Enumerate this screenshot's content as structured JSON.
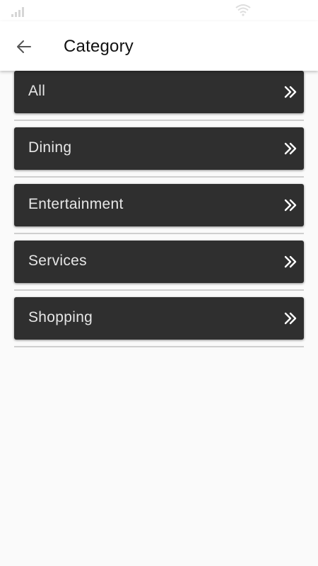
{
  "header": {
    "title": "Category"
  },
  "categories": [
    {
      "label": "All"
    },
    {
      "label": "Dining"
    },
    {
      "label": "Entertainment"
    },
    {
      "label": "Services"
    },
    {
      "label": "Shopping"
    }
  ],
  "icons": {
    "status_left": "signal-icon",
    "status_right": "wifi-icon",
    "back": "arrow-left-icon",
    "row_action": "double-chevron-right-icon"
  },
  "colors": {
    "item_background": "#2f2f2f",
    "item_text": "#e6e6e6",
    "page_background": "#fafafa",
    "divider": "#cfcfcf"
  }
}
